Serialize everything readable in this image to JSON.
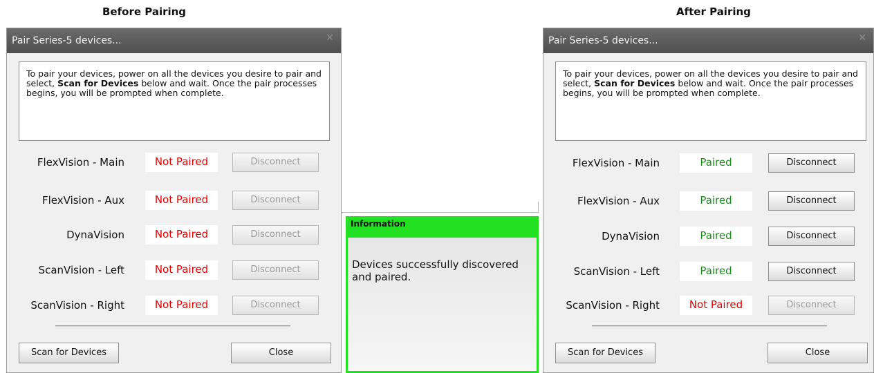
{
  "captions": {
    "before": "Before Pairing",
    "after": "After Pairing"
  },
  "before": {
    "title": "Pair Series-5 devices...",
    "instructions": {
      "pre": "To pair your devices, power on all the devices you desire to pair and select, ",
      "bold": "Scan for Devices",
      "post": " below and wait. Once the pair processes begins, you will be prompted when complete."
    },
    "devices": [
      {
        "name": "FlexVision - Main",
        "status": "Not Paired",
        "action": "Disconnect"
      },
      {
        "name": "FlexVision - Aux",
        "status": "Not Paired",
        "action": "Disconnect"
      },
      {
        "name": "DynaVision",
        "status": "Not Paired",
        "action": "Disconnect"
      },
      {
        "name": "ScanVision - Left",
        "status": "Not Paired",
        "action": "Disconnect"
      },
      {
        "name": "ScanVision - Right",
        "status": "Not Paired",
        "action": "Disconnect"
      }
    ],
    "scan_label": "Scan for Devices",
    "close_label": "Close"
  },
  "after": {
    "title": "Pair Series-5 devices...",
    "instructions": {
      "pre": "To pair your devices, power on all the devices you desire to pair and select, ",
      "bold": "Scan for Devices",
      "post": " below and wait. Once the pair processes begins, you will be prompted when complete."
    },
    "devices": [
      {
        "name": "FlexVision - Main",
        "status": "Paired",
        "action": "Disconnect"
      },
      {
        "name": "FlexVision - Aux",
        "status": "Paired",
        "action": "Disconnect"
      },
      {
        "name": "DynaVision",
        "status": "Paired",
        "action": "Disconnect"
      },
      {
        "name": "ScanVision - Left",
        "status": "Paired",
        "action": "Disconnect"
      },
      {
        "name": "ScanVision - Right",
        "status": "Not Paired",
        "action": "Disconnect"
      }
    ],
    "scan_label": "Scan for Devices",
    "close_label": "Close"
  },
  "info": {
    "title": "Information",
    "message": "Devices successfully discovered and paired."
  },
  "colors": {
    "paired": "#1c8a1c",
    "not_paired": "#e00000",
    "info_border": "#22e022"
  },
  "icons": {
    "close": "close-icon"
  }
}
